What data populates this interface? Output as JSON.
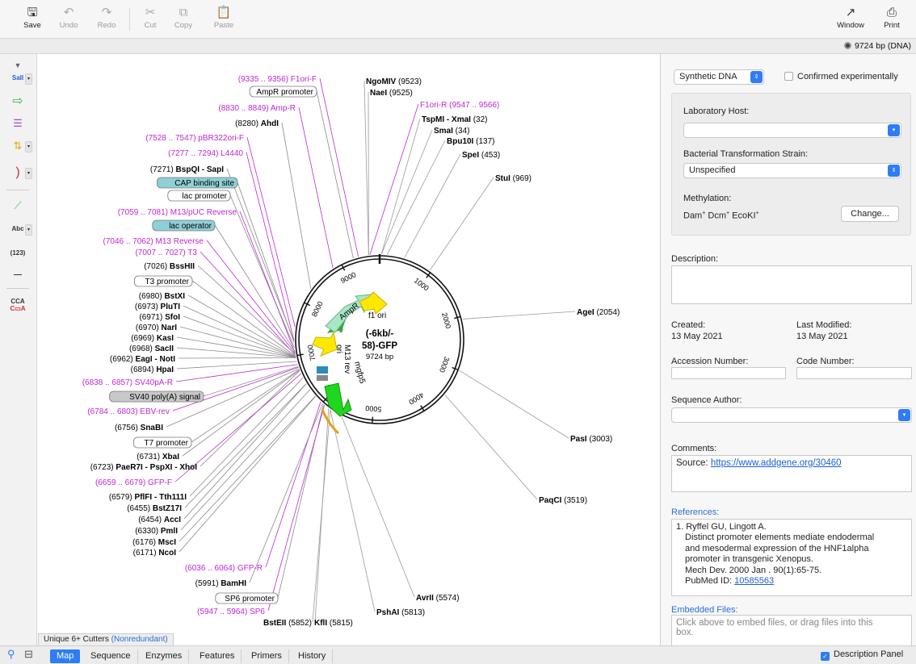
{
  "toolbar": {
    "save": "Save",
    "undo": "Undo",
    "redo": "Redo",
    "cut": "Cut",
    "copy": "Copy",
    "paste": "Paste",
    "window": "Window",
    "print": "Print"
  },
  "sequence_size": "9724 bp  (DNA)",
  "map": {
    "name_line1": "(-6kb/-",
    "name_line2": "58)-GFP",
    "length": "9724 bp",
    "ticks": [
      "1000",
      "2000",
      "3000",
      "4000",
      "5000",
      "6000",
      "7000",
      "8000",
      "9000"
    ],
    "feature_labels": [
      "AmpR",
      "f1 ori",
      "ori",
      "M13 rev",
      "mgfp5"
    ],
    "right_labels": [
      {
        "name": "NgoMIV",
        "pos": "(9523)",
        "type": "enzyme"
      },
      {
        "name": "NaeI",
        "pos": "(9525)",
        "type": "enzyme"
      },
      {
        "name": "F1ori-R",
        "pos": "(9547 .. 9566)",
        "type": "primer"
      },
      {
        "name": "TspMI - XmaI",
        "pos": "(32)",
        "type": "enzyme"
      },
      {
        "name": "SmaI",
        "pos": "(34)",
        "type": "enzyme"
      },
      {
        "name": "Bpu10I",
        "pos": "(137)",
        "type": "enzyme"
      },
      {
        "name": "SpeI",
        "pos": "(453)",
        "type": "enzyme"
      },
      {
        "name": "StuI",
        "pos": "(969)",
        "type": "enzyme"
      },
      {
        "name": "AgeI",
        "pos": "(2054)",
        "type": "enzyme"
      },
      {
        "name": "PasI",
        "pos": "(3003)",
        "type": "enzyme"
      },
      {
        "name": "PaqCI",
        "pos": "(3519)",
        "type": "enzyme"
      },
      {
        "name": "AvrII",
        "pos": "(5574)",
        "type": "enzyme"
      },
      {
        "name": "PshAI",
        "pos": "(5813)",
        "type": "enzyme"
      },
      {
        "name": "KflI",
        "pos": "(5815)",
        "type": "enzyme"
      },
      {
        "name": "BstEII",
        "pos": "(5852)",
        "type": "enzyme"
      }
    ],
    "left_labels": [
      {
        "pos": "(9335 .. 9356)",
        "name": "F1ori-F",
        "type": "primer"
      },
      {
        "name": "AmpR promoter",
        "type": "feature"
      },
      {
        "pos": "(8830 .. 8849)",
        "name": "Amp-R",
        "type": "primer"
      },
      {
        "pos": "(8280)",
        "name": "AhdI",
        "type": "enzyme"
      },
      {
        "pos": "(7528 .. 7547)",
        "name": "pBR322ori-F",
        "type": "primer"
      },
      {
        "pos": "(7277 .. 7294)",
        "name": "L4440",
        "type": "primer"
      },
      {
        "pos": "(7271)",
        "name": "BspQI - SapI",
        "type": "enzyme"
      },
      {
        "name": "CAP binding site",
        "type": "feature-blue"
      },
      {
        "name": "lac promoter",
        "type": "feature"
      },
      {
        "pos": "(7059 .. 7081)",
        "name": "M13/pUC Reverse",
        "type": "primer"
      },
      {
        "name": "lac operator",
        "type": "feature-blue"
      },
      {
        "pos": "(7046 .. 7062)",
        "name": "M13 Reverse",
        "type": "primer"
      },
      {
        "pos": "(7007 .. 7027)",
        "name": "T3",
        "type": "primer"
      },
      {
        "pos": "(7026)",
        "name": "BssHII",
        "type": "enzyme"
      },
      {
        "name": "T3 promoter",
        "type": "feature"
      },
      {
        "pos": "(6980)",
        "name": "BstXI",
        "type": "enzyme"
      },
      {
        "pos": "(6973)",
        "name": "PluTI",
        "type": "enzyme"
      },
      {
        "pos": "(6971)",
        "name": "SfoI",
        "type": "enzyme"
      },
      {
        "pos": "(6970)",
        "name": "NarI",
        "type": "enzyme"
      },
      {
        "pos": "(6969)",
        "name": "KasI",
        "type": "enzyme"
      },
      {
        "pos": "(6968)",
        "name": "SacII",
        "type": "enzyme"
      },
      {
        "pos": "(6962)",
        "name": "EagI - NotI",
        "type": "enzyme"
      },
      {
        "pos": "(6894)",
        "name": "HpaI",
        "type": "enzyme"
      },
      {
        "pos": "(6838 .. 6857)",
        "name": "SV40pA-R",
        "type": "primer"
      },
      {
        "name": "SV40 poly(A) signal",
        "type": "feature-gray"
      },
      {
        "pos": "(6784 .. 6803)",
        "name": "EBV-rev",
        "type": "primer"
      },
      {
        "pos": "(6756)",
        "name": "SnaBI",
        "type": "enzyme"
      },
      {
        "name": "T7 promoter",
        "type": "feature"
      },
      {
        "pos": "(6731)",
        "name": "XbaI",
        "type": "enzyme"
      },
      {
        "pos": "(6723)",
        "name": "PaeR7I - PspXI - XhoI",
        "type": "enzyme"
      },
      {
        "pos": "(6659 .. 6679)",
        "name": "GFP-F",
        "type": "primer"
      },
      {
        "pos": "(6579)",
        "name": "PflFI - Tth111I",
        "type": "enzyme"
      },
      {
        "pos": "(6455)",
        "name": "BstZ17I",
        "type": "enzyme"
      },
      {
        "pos": "(6454)",
        "name": "AccI",
        "type": "enzyme"
      },
      {
        "pos": "(6330)",
        "name": "PmlI",
        "type": "enzyme"
      },
      {
        "pos": "(6176)",
        "name": "MscI",
        "type": "enzyme"
      },
      {
        "pos": "(6171)",
        "name": "NcoI",
        "type": "enzyme"
      },
      {
        "pos": "(6036 .. 6064)",
        "name": "GFP-R",
        "type": "primer"
      },
      {
        "pos": "(5991)",
        "name": "BamHI",
        "type": "enzyme"
      },
      {
        "name": "SP6 promoter",
        "type": "feature"
      },
      {
        "pos": "(5947 .. 5964)",
        "name": "SP6",
        "type": "primer"
      }
    ],
    "cutters_prefix": "Unique 6+ Cutters",
    "cutters_suffix": "(Nonredundant)"
  },
  "panel": {
    "molecule_type": "Synthetic DNA",
    "confirmed": "Confirmed experimentally",
    "lab_host_label": "Laboratory Host:",
    "lab_host_value": "",
    "strain_label": "Bacterial Transformation Strain:",
    "strain_value": "Unspecified",
    "methylation_label": "Methylation:",
    "methylation_dam": "Dam",
    "methylation_dcm": "Dcm",
    "methylation_eco": "EcoKI",
    "methylation_sup": "+",
    "change_button": "Change...",
    "description_label": "Description:",
    "created_label": "Created:",
    "created_value": "13 May 2021",
    "modified_label": "Last Modified:",
    "modified_value": "13 May 2021",
    "accession_label": "Accession Number:",
    "code_label": "Code Number:",
    "author_label": "Sequence Author:",
    "comments_label": "Comments:",
    "comments_prefix": "Source: ",
    "comments_link": "https://www.addgene.org/30460",
    "references_label": "References:",
    "ref_line1": "1. Ryffel GU, Lingott A.",
    "ref_line2": "Distinct promoter elements mediate endodermal",
    "ref_line3": "and mesodermal expression of the HNF1alpha",
    "ref_line4": "promoter in transgenic Xenopus.",
    "ref_line5": "Mech Dev. 2000 Jan . 90(1):65-75.",
    "ref_pubmed_prefix": "PubMed ID:",
    "ref_pubmed_id": "10585563",
    "embedded_label": "Embedded Files:",
    "embedded_hint_line1": "Click above to embed files, or drag files into this",
    "embedded_hint_line2": "box."
  },
  "bottom_tabs": [
    "Map",
    "Sequence",
    "Enzymes",
    "Features",
    "Primers",
    "History"
  ],
  "description_panel": "Description Panel",
  "colors": {
    "accent": "#2e7cf6",
    "primer": "#c026d3",
    "feature_blue": "#8fd0d6",
    "feature_gray": "#c8c8c8",
    "ampr": "#a8e6c5",
    "gfp": "#1ed71e",
    "ori": "#ffe800",
    "promoter_arrow": "#e3a21a"
  }
}
